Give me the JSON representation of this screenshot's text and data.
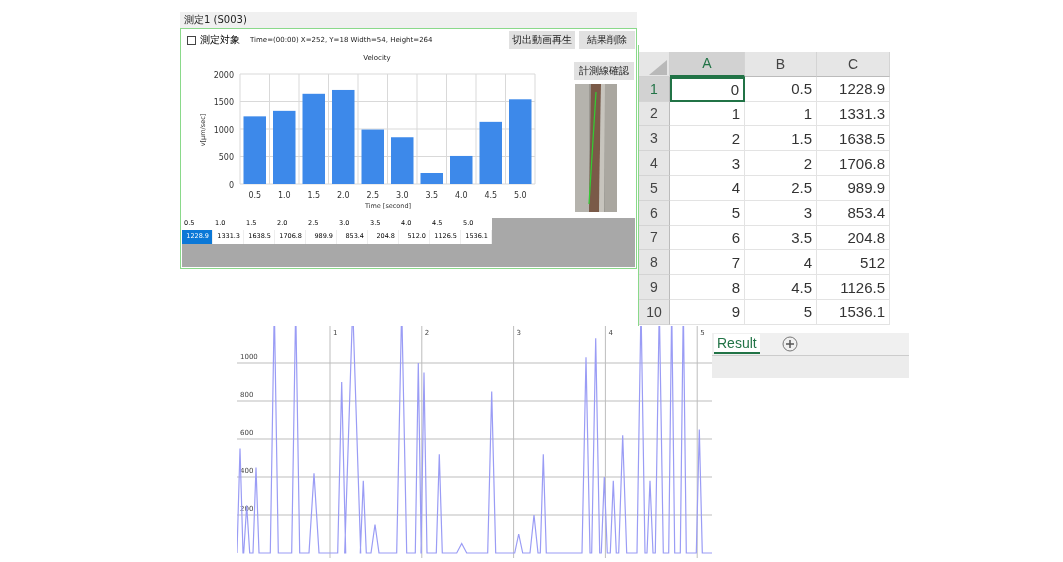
{
  "measurement_panel": {
    "tab_title": "測定1 (S003)",
    "target_checkbox": {
      "label": "測定対象",
      "checked": false
    },
    "info": "Time=(00:00) X=252, Y=18 Width=54, Height=264",
    "buttons": [
      "切出動画再生",
      "結果削除"
    ],
    "side_button": "計測線確認",
    "chart_data": {
      "type": "bar",
      "title": "Velocity",
      "xlabel": "Time [second]",
      "ylabel": "v[μm/sec]",
      "categories": [
        "0.5",
        "1.0",
        "1.5",
        "2.0",
        "2.5",
        "3.0",
        "3.5",
        "4.0",
        "4.5",
        "5.0"
      ],
      "series": [
        {
          "color": "#3d89ea",
          "values": [
            1230,
            1330,
            1640,
            1710,
            990,
            850,
            200,
            510,
            1130,
            1540
          ]
        }
      ],
      "ylim": [
        0,
        2000
      ],
      "yticks": [
        0,
        500,
        1000,
        1500,
        2000
      ],
      "grid": true
    },
    "data_grid": {
      "headers": [
        "0.5",
        "1.0",
        "1.5",
        "2.0",
        "2.5",
        "3.0",
        "3.5",
        "4.0",
        "4.5",
        "5.0"
      ],
      "values": [
        {
          "text": "1228.9",
          "selected": true
        },
        {
          "text": "1331.3",
          "selected": false
        },
        {
          "text": "1638.5",
          "selected": false
        },
        {
          "text": "1706.8",
          "selected": false
        },
        {
          "text": "989.9",
          "selected": false
        },
        {
          "text": "853.4",
          "selected": false
        },
        {
          "text": "204.8",
          "selected": false
        },
        {
          "text": "512.0",
          "selected": false
        },
        {
          "text": "1126.5",
          "selected": false
        },
        {
          "text": "1536.1",
          "selected": false
        }
      ]
    }
  },
  "spreadsheet": {
    "columns": [
      {
        "label": "A",
        "selected": true
      },
      {
        "label": "B",
        "selected": false
      },
      {
        "label": "C",
        "selected": false
      }
    ],
    "rows": [
      {
        "number": "1",
        "selected": true,
        "cells": [
          "0",
          "0.5",
          "1228.9"
        ]
      },
      {
        "number": "2",
        "selected": false,
        "cells": [
          "1",
          "1",
          "1331.3"
        ]
      },
      {
        "number": "3",
        "selected": false,
        "cells": [
          "2",
          "1.5",
          "1638.5"
        ]
      },
      {
        "number": "4",
        "selected": false,
        "cells": [
          "3",
          "2",
          "1706.8"
        ]
      },
      {
        "number": "5",
        "selected": false,
        "cells": [
          "4",
          "2.5",
          "989.9"
        ]
      },
      {
        "number": "6",
        "selected": false,
        "cells": [
          "5",
          "3",
          "853.4"
        ]
      },
      {
        "number": "7",
        "selected": false,
        "cells": [
          "6",
          "3.5",
          "204.8"
        ]
      },
      {
        "number": "8",
        "selected": false,
        "cells": [
          "7",
          "4",
          "512"
        ]
      },
      {
        "number": "9",
        "selected": false,
        "cells": [
          "8",
          "4.5",
          "1126.5"
        ]
      },
      {
        "number": "10",
        "selected": false,
        "cells": [
          "9",
          "5",
          "1536.1"
        ]
      }
    ],
    "sheet_tabs": [
      {
        "label": "Result",
        "selected": true
      }
    ]
  },
  "waveform": {
    "y_labels": [
      "1000",
      "800",
      "600",
      "400",
      "200"
    ],
    "x_labels": [
      "1",
      "2",
      "3",
      "4",
      "5"
    ]
  }
}
